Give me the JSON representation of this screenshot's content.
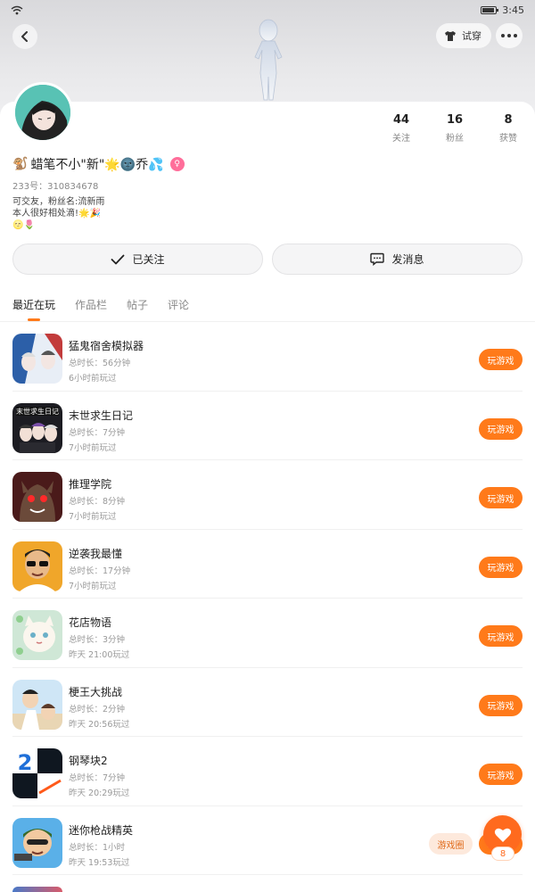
{
  "status_bar": {
    "time": "3:45",
    "battery_level": 0.85
  },
  "header": {
    "try_on_label": "试穿"
  },
  "profile": {
    "stats": [
      {
        "num": "44",
        "label": "关注"
      },
      {
        "num": "16",
        "label": "粉丝"
      },
      {
        "num": "8",
        "label": "获赞"
      }
    ],
    "nickname_prefix": "🐒",
    "nickname": "蜡笔不小\"新\"🌟🌚乔💦",
    "uid": "233号：310834678",
    "bio_line1": "可交友，粉丝名:流新雨",
    "bio_line2": "本人很好相处滴!🌟🎉",
    "bio_line3": "🌝🌷"
  },
  "actions": {
    "followed_label": "已关注",
    "message_label": "发消息"
  },
  "tabs": [
    "最近在玩",
    "作品栏",
    "帖子",
    "评论"
  ],
  "games": [
    {
      "title": "猛鬼宿舍模拟器",
      "duration": "总时长：56分钟",
      "time": "6小时前玩过",
      "button": "玩游戏"
    },
    {
      "title": "末世求生日记",
      "duration": "总时长：7分钟",
      "time": "7小时前玩过",
      "button": "玩游戏"
    },
    {
      "title": "推理学院",
      "duration": "总时长：8分钟",
      "time": "7小时前玩过",
      "button": "玩游戏"
    },
    {
      "title": "逆袭我最懂",
      "duration": "总时长：17分钟",
      "time": "7小时前玩过",
      "button": "玩游戏"
    },
    {
      "title": "花店物语",
      "duration": "总时长：3分钟",
      "time": "昨天 21:00玩过",
      "button": "玩游戏"
    },
    {
      "title": "梗王大挑战",
      "duration": "总时长：2分钟",
      "time": "昨天 20:56玩过",
      "button": "玩游戏"
    },
    {
      "title": "钢琴块2",
      "duration": "总时长：7分钟",
      "time": "昨天 20:29玩过",
      "button": "玩游戏"
    },
    {
      "title": "迷你枪战精英",
      "duration": "总时长：1小时",
      "time": "昨天 19:53玩过",
      "button": "玩游戏"
    }
  ],
  "floating": {
    "circle_label": "游戏圈",
    "like_count": "8"
  },
  "colors": {
    "accent": "#ff7a1a",
    "text": "#222222",
    "muted": "#888888"
  }
}
